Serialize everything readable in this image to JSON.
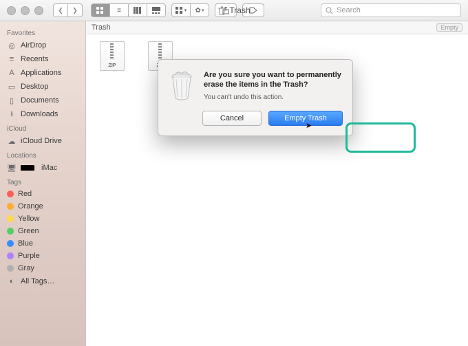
{
  "window": {
    "title": "Trash"
  },
  "toolbar": {
    "search_placeholder": "Search"
  },
  "pathbar": {
    "location": "Trash",
    "empty_label": "Empty"
  },
  "files": [
    {
      "type": "ZIP"
    },
    {
      "type": "ZIP"
    }
  ],
  "sidebar": {
    "sections": [
      {
        "header": "Favorites",
        "items": [
          {
            "icon": "airdrop-icon",
            "label": "AirDrop"
          },
          {
            "icon": "recents-icon",
            "label": "Recents"
          },
          {
            "icon": "apps-icon",
            "label": "Applications"
          },
          {
            "icon": "desktop-icon",
            "label": "Desktop"
          },
          {
            "icon": "documents-icon",
            "label": "Documents"
          },
          {
            "icon": "downloads-icon",
            "label": "Downloads"
          }
        ]
      },
      {
        "header": "iCloud",
        "items": [
          {
            "icon": "icloud-icon",
            "label": "iCloud Drive"
          }
        ]
      },
      {
        "header": "Locations",
        "items": [
          {
            "icon": "imac-icon",
            "label": "iMac"
          }
        ]
      },
      {
        "header": "Tags",
        "items": [
          {
            "color": "#ff5f56",
            "label": "Red"
          },
          {
            "color": "#ffab2d",
            "label": "Orange"
          },
          {
            "color": "#ffd84d",
            "label": "Yellow"
          },
          {
            "color": "#4fd063",
            "label": "Green"
          },
          {
            "color": "#3a8cff",
            "label": "Blue"
          },
          {
            "color": "#b180ff",
            "label": "Purple"
          },
          {
            "color": "#b0b0b0",
            "label": "Gray"
          },
          {
            "icon": "alltags-icon",
            "label": "All Tags…"
          }
        ]
      }
    ]
  },
  "dialog": {
    "heading": "Are you sure you want to permanently erase the items in the Trash?",
    "sub": "You can't undo this action.",
    "cancel": "Cancel",
    "confirm": "Empty Trash"
  }
}
